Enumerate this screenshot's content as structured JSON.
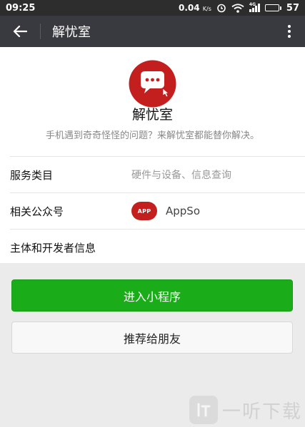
{
  "status_bar": {
    "time": "09:25",
    "network_speed": "0.04",
    "network_unit": "K/s",
    "signal_label": "4G",
    "battery_level": "57",
    "battery_fraction": 0.57
  },
  "app_bar": {
    "title": "解忧室",
    "icons": {
      "back": "back-arrow-icon",
      "more": "more-vertical-icon"
    }
  },
  "profile": {
    "name": "解忧室",
    "description": "手机遇到奇奇怪怪的问题？来解忧室都能替你解决。",
    "logo_icon": "chat-bubble-logo",
    "colors": {
      "logo_red": "#c41f1f"
    }
  },
  "info_rows": {
    "category": {
      "label": "服务类目",
      "value": "硬件与设备、信息查询"
    },
    "related_account": {
      "label": "相关公众号",
      "badge": "APP",
      "name": "AppSo"
    },
    "developer": {
      "label": "主体和开发者信息"
    }
  },
  "buttons": {
    "enter": "进入小程序",
    "recommend": "推荐给朋友"
  },
  "colors": {
    "primary_green": "#1aad19",
    "app_bar": "#393a3f"
  }
}
